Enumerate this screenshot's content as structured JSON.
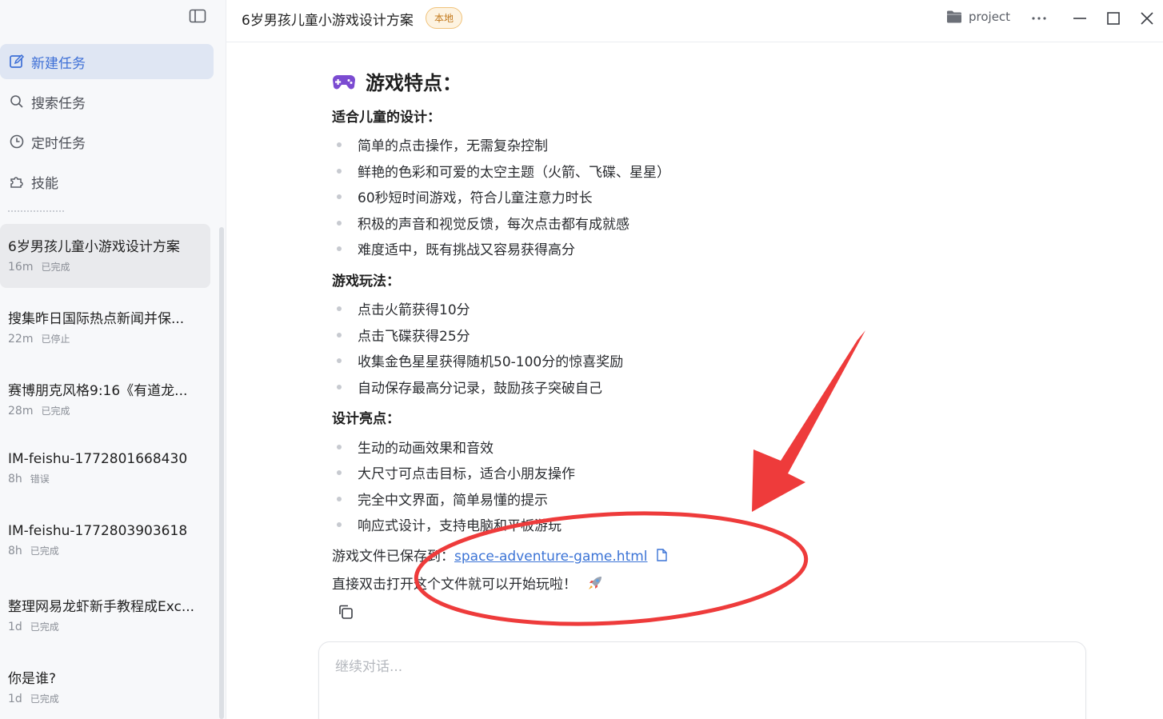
{
  "sidebar": {
    "nav": [
      {
        "label": "新建任务",
        "icon": "edit-icon"
      },
      {
        "label": "搜索任务",
        "icon": "search-icon"
      },
      {
        "label": "定时任务",
        "icon": "clock-icon"
      },
      {
        "label": "技能",
        "icon": "puzzle-icon"
      }
    ],
    "tasks": [
      {
        "title": "6岁男孩儿童小游戏设计方案",
        "time": "16m",
        "status": "已完成"
      },
      {
        "title": "搜集昨日国际热点新闻并保...",
        "time": "22m",
        "status": "已停止"
      },
      {
        "title": "赛博朋克风格9:16《有道龙...",
        "time": "28m",
        "status": "已完成"
      },
      {
        "title": "IM-feishu-1772801668430",
        "time": "8h",
        "status": "错误"
      },
      {
        "title": "IM-feishu-1772803903618",
        "time": "8h",
        "status": "已完成"
      },
      {
        "title": "整理网易龙虾新手教程成Exc...",
        "time": "1d",
        "status": "已完成"
      },
      {
        "title": "你是谁?",
        "time": "1d",
        "status": "已完成"
      }
    ]
  },
  "header": {
    "title": "6岁男孩儿童小游戏设计方案",
    "badge": "本地",
    "project": "project"
  },
  "content": {
    "heading": "游戏特点：",
    "sections": [
      {
        "title": "适合儿童的设计：",
        "items": [
          "简单的点击操作，无需复杂控制",
          "鲜艳的色彩和可爱的太空主题（火箭、飞碟、星星）",
          "60秒短时间游戏，符合儿童注意力时长",
          "积极的声音和视觉反馈，每次点击都有成就感",
          "难度适中，既有挑战又容易获得高分"
        ]
      },
      {
        "title": "游戏玩法：",
        "items": [
          "点击火箭获得10分",
          "点击飞碟获得25分",
          "收集金色星星获得随机50-100分的惊喜奖励",
          "自动保存最高分记录，鼓励孩子突破自己"
        ]
      },
      {
        "title": "设计亮点：",
        "items": [
          "生动的动画效果和音效",
          "大尺寸可点击目标，适合小朋友操作",
          "完全中文界面，简单易懂的提示",
          "响应式设计，支持电脑和平板游玩"
        ]
      }
    ],
    "saved_prefix": "游戏文件已保存到：",
    "saved_file": "space-adventure-game.html",
    "closing": "直接双击打开这个文件就可以开始玩啦！"
  },
  "input": {
    "placeholder": "继续对话..."
  },
  "colors": {
    "accent": "#3c74d6",
    "badge_bg": "#fdf3e1",
    "badge_text": "#c2781a",
    "annotation": "#ee3b3b"
  }
}
